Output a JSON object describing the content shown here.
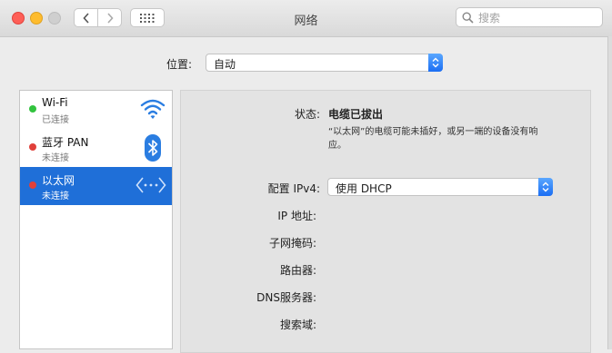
{
  "window": {
    "title": "网络"
  },
  "search": {
    "placeholder": "搜索"
  },
  "location": {
    "label": "位置:",
    "value": "自动"
  },
  "services": [
    {
      "name": "Wi-Fi",
      "status": "已连接",
      "status_color": "#32c33e",
      "icon": "wifi-icon"
    },
    {
      "name": "蓝牙 PAN",
      "status": "未连接",
      "status_color": "#e0403a",
      "icon": "bluetooth-icon"
    },
    {
      "name": "以太网",
      "status": "未连接",
      "status_color": "#e0403a",
      "icon": "ethernet-icon",
      "selected": true
    }
  ],
  "detail": {
    "status_label": "状态:",
    "status_value": "电缆已拔出",
    "status_description": "“以太网”的电缆可能未插好，或另一端的设备没有响应。",
    "ipv4_label": "配置 IPv4:",
    "ipv4_value": "使用 DHCP",
    "ip_label": "IP 地址:",
    "subnet_label": "子网掩码:",
    "router_label": "路由器:",
    "dns_label": "DNS服务器:",
    "search_domain_label": "搜索域:"
  },
  "colors": {
    "accent": "#1f6fd8",
    "connected": "#32c33e",
    "disconnected": "#e0403a"
  }
}
